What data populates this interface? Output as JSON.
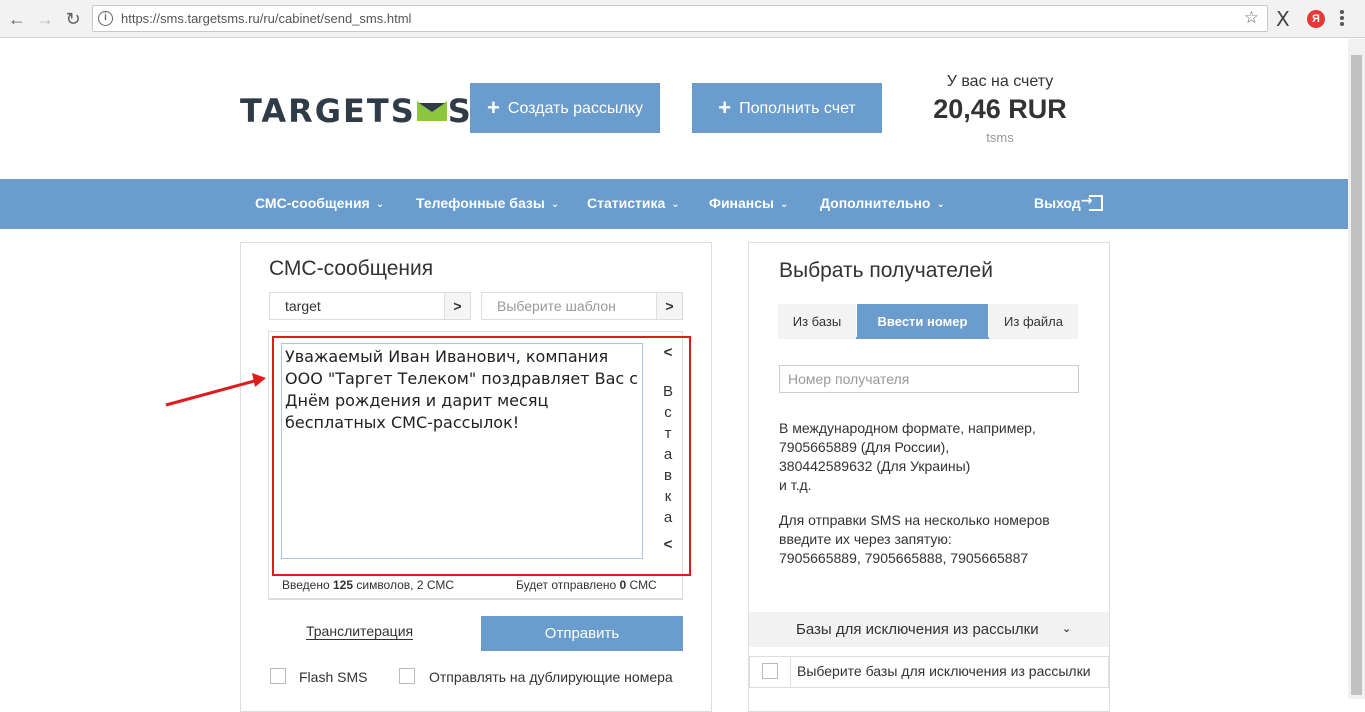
{
  "browser": {
    "back": "←",
    "forward": "→",
    "reload": "↻",
    "url": "https://sms.targetsms.ru/ru/cabinet/send_sms.html",
    "star": "☆",
    "ext_x": "X",
    "ext_ya": "Я"
  },
  "header": {
    "logo_left": "TARGETS",
    "logo_right": "S",
    "create_button": "Создать рассылку",
    "topup_button": "Пополнить счет",
    "plus": "+",
    "balance_label": "У вас на счету",
    "balance_value": "20,46 RUR",
    "balance_sub": "tsms",
    "brand_color": "#6a9ccd"
  },
  "nav": {
    "items": [
      {
        "label": "СМС-сообщения"
      },
      {
        "label": "Телефонные базы"
      },
      {
        "label": "Статистика"
      },
      {
        "label": "Финансы"
      },
      {
        "label": "Дополнительно"
      }
    ],
    "chevron": "⌄",
    "logout": "Выход"
  },
  "sms_panel": {
    "title": "СМС-сообщения",
    "sender_value": "target",
    "template_placeholder": "Выберите шаблон",
    "arrow": ">",
    "message": "Уважаемый Иван Иванович, компания ООО \"Таргет Телеком\" поздравляет Вас с Днём рождения и дарит месяц бесплатных СМС-рассылок!",
    "insert_letters": [
      "В",
      "с",
      "т",
      "а",
      "в",
      "к",
      "а"
    ],
    "insert_chevron": "<",
    "counter_prefix": "Введено",
    "counter_count": "125",
    "counter_suffix": "символов, 2 СМС",
    "sent_prefix": "Будет отправлено",
    "sent_count": "0",
    "sent_suffix": "СМС",
    "translit_link": "Транслитерация",
    "send_button": "Отправить",
    "flash_label": "Flash SMS",
    "dup_label": "Отправлять на дублирующие номера"
  },
  "recipients_panel": {
    "title": "Выбрать получателей",
    "tabs": [
      {
        "label": "Из базы",
        "active": false
      },
      {
        "label": "Ввести номер",
        "active": true
      },
      {
        "label": "Из файла",
        "active": false
      }
    ],
    "recipient_placeholder": "Номер получателя",
    "help1": [
      "В международном формате, например,",
      "7905665889 (Для России),",
      "380442589632 (Для Украины)",
      "и т.д."
    ],
    "help2": [
      "Для отправки SMS на несколько номеров",
      "введите их через запятую:",
      "7905665889, 7905665888, 7905665887"
    ],
    "exclusions_header": "Базы для исключения из рассылки",
    "exclusions_chevron": "⌄",
    "exclusions_row": "Выберите базы для исключения из рассылки"
  },
  "annotation": {
    "arrow_color": "#e01b1b",
    "frame_color": "#e01b1b"
  }
}
